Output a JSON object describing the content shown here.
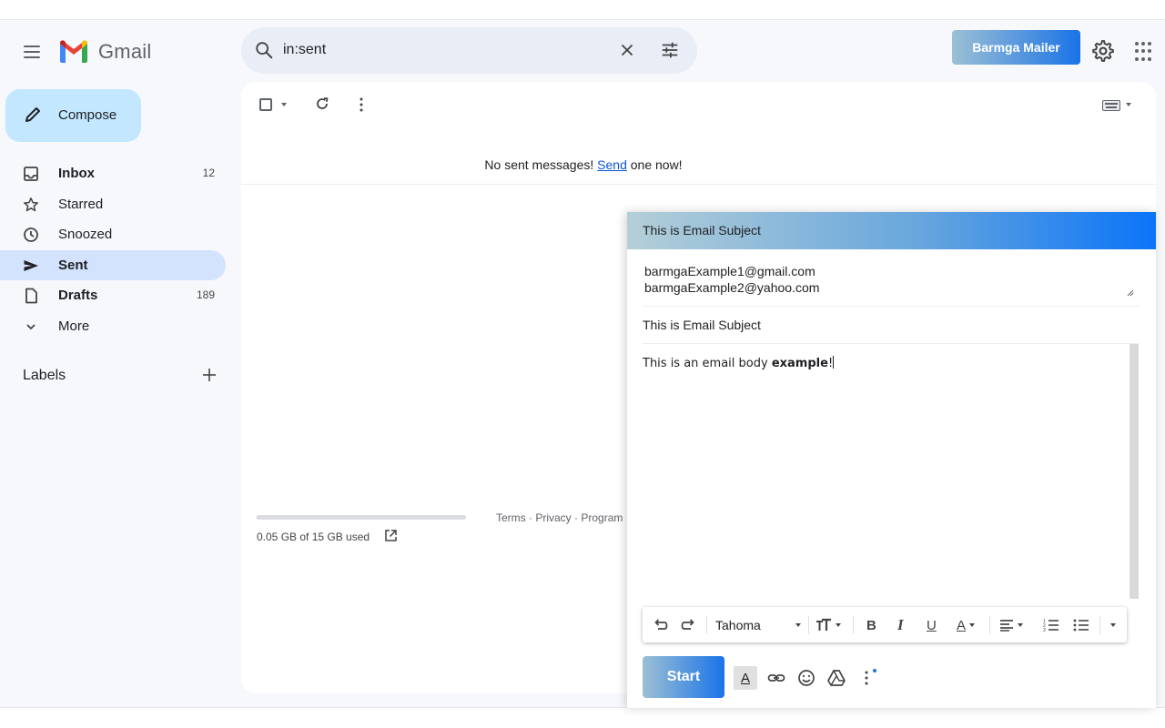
{
  "app": {
    "logo_text": "Gmail",
    "extension_button": "Barmga Mailer"
  },
  "search": {
    "value": "in:sent"
  },
  "sidebar": {
    "compose_label": "Compose",
    "items": [
      {
        "label": "Inbox",
        "count": "12",
        "icon": "inbox-icon"
      },
      {
        "label": "Starred",
        "count": "",
        "icon": "star-icon"
      },
      {
        "label": "Snoozed",
        "count": "",
        "icon": "clock-icon"
      },
      {
        "label": "Sent",
        "count": "",
        "icon": "send-icon"
      },
      {
        "label": "Drafts",
        "count": "189",
        "icon": "draft-icon"
      },
      {
        "label": "More",
        "count": "",
        "icon": "chevron-down-icon"
      }
    ],
    "labels_heading": "Labels"
  },
  "main": {
    "empty_prefix": "No sent messages! ",
    "empty_link": "Send",
    "empty_suffix": " one now!",
    "storage_text": "0.05 GB of 15 GB used",
    "storage_fraction": 0.0033,
    "footer": {
      "terms": "Terms",
      "privacy": "Privacy",
      "program": "Program"
    }
  },
  "compose_window": {
    "title": "This is Email Subject",
    "recipients": [
      "barmgaExample1@gmail.com",
      "barmgaExample2@yahoo.com"
    ],
    "subject": "This is Email Subject",
    "body_plain": "This is an email body ",
    "body_bold": "example",
    "body_end": "!",
    "font_name": "Tahoma",
    "send_label": "Start"
  },
  "colors": {
    "accent": "#1a73e8",
    "active_nav": "#d3e3fd",
    "compose_bg": "#c2e7ff"
  }
}
